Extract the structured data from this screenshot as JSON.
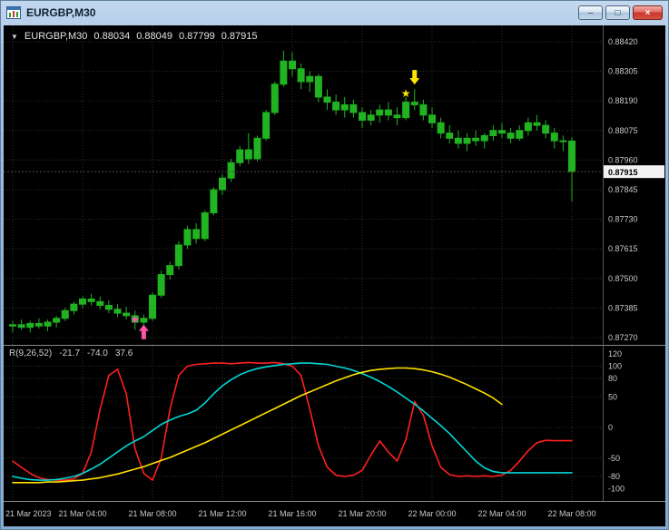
{
  "window": {
    "title": "EURGBP,M30",
    "controls": [
      {
        "name": "minimize",
        "glyph": "–"
      },
      {
        "name": "maximize",
        "glyph": "□"
      },
      {
        "name": "close",
        "glyph": "×"
      }
    ]
  },
  "colors": {
    "background": "#000000",
    "grid": "#2f2f2f",
    "candle": "#21b321",
    "axis_text": "#c9c9c9",
    "price_box_bg": "#f2f2f2",
    "price_box_text": "#000000",
    "separator": "#8a8a8a",
    "axis_separator": "#5a5a5a",
    "price_line": "#4a4a4a"
  },
  "chart_data": [
    {
      "type": "candlestick",
      "symbol": "EURGBP,M30",
      "collapse_marker": "▼",
      "ohlc_display": {
        "open": "0.88034",
        "high": "0.88049",
        "low": "0.87799",
        "close": "0.87915"
      },
      "x_tick_labels": [
        "21 Mar 2023",
        "21 Mar 04:00",
        "21 Mar 08:00",
        "21 Mar 12:00",
        "21 Mar 16:00",
        "21 Mar 20:00",
        "22 Mar 00:00",
        "22 Mar 04:00",
        "22 Mar 08:00"
      ],
      "ticks_per_label": 8,
      "y_axis_ticks": [
        "0.88420",
        "0.88305",
        "0.88190",
        "0.88075",
        "0.87960",
        "0.87845",
        "0.87730",
        "0.87615",
        "0.87500",
        "0.87385",
        "0.87270"
      ],
      "current_price": "0.87915",
      "candles": [
        [
          0.87315,
          0.87335,
          0.8729,
          0.8732
        ],
        [
          0.8732,
          0.8734,
          0.873,
          0.8731
        ],
        [
          0.8731,
          0.87335,
          0.8729,
          0.87325
        ],
        [
          0.87325,
          0.87345,
          0.87305,
          0.87315
        ],
        [
          0.87315,
          0.8734,
          0.87295,
          0.8733
        ],
        [
          0.8733,
          0.87355,
          0.8731,
          0.87345
        ],
        [
          0.87345,
          0.87385,
          0.87335,
          0.87375
        ],
        [
          0.87375,
          0.8741,
          0.8736,
          0.874
        ],
        [
          0.874,
          0.8743,
          0.87385,
          0.8742
        ],
        [
          0.8742,
          0.8744,
          0.87395,
          0.8741
        ],
        [
          0.8741,
          0.8743,
          0.8738,
          0.87395
        ],
        [
          0.87395,
          0.87415,
          0.87365,
          0.8738
        ],
        [
          0.8738,
          0.874,
          0.8735,
          0.87365
        ],
        [
          0.87365,
          0.8739,
          0.8734,
          0.87355
        ],
        [
          0.87355,
          0.87375,
          0.873,
          0.8733
        ],
        [
          0.8733,
          0.8736,
          0.87285,
          0.87345
        ],
        [
          0.87345,
          0.87445,
          0.87335,
          0.87435
        ],
        [
          0.87435,
          0.8753,
          0.87425,
          0.87515
        ],
        [
          0.87515,
          0.87565,
          0.87495,
          0.8755
        ],
        [
          0.8755,
          0.87645,
          0.87535,
          0.8763
        ],
        [
          0.8763,
          0.87705,
          0.87615,
          0.8769
        ],
        [
          0.8769,
          0.87715,
          0.87635,
          0.87655
        ],
        [
          0.87655,
          0.87765,
          0.87645,
          0.87755
        ],
        [
          0.87755,
          0.87855,
          0.87745,
          0.87845
        ],
        [
          0.87845,
          0.87905,
          0.87825,
          0.8789
        ],
        [
          0.8789,
          0.87965,
          0.87875,
          0.8795
        ],
        [
          0.8795,
          0.88015,
          0.87935,
          0.88
        ],
        [
          0.88,
          0.88065,
          0.87945,
          0.87965
        ],
        [
          0.87965,
          0.88055,
          0.87955,
          0.88045
        ],
        [
          0.88045,
          0.88155,
          0.88035,
          0.88145
        ],
        [
          0.88145,
          0.88265,
          0.88135,
          0.88255
        ],
        [
          0.88255,
          0.88385,
          0.88245,
          0.88345
        ],
        [
          0.88345,
          0.8838,
          0.88285,
          0.88315
        ],
        [
          0.88315,
          0.88335,
          0.88235,
          0.88265
        ],
        [
          0.88265,
          0.88305,
          0.88225,
          0.88285
        ],
        [
          0.88285,
          0.88295,
          0.88185,
          0.88205
        ],
        [
          0.88205,
          0.88235,
          0.88155,
          0.88185
        ],
        [
          0.88185,
          0.88215,
          0.88135,
          0.88155
        ],
        [
          0.88155,
          0.88205,
          0.88125,
          0.88175
        ],
        [
          0.88175,
          0.88195,
          0.88125,
          0.88145
        ],
        [
          0.88145,
          0.88165,
          0.88085,
          0.88115
        ],
        [
          0.88115,
          0.88155,
          0.88095,
          0.88135
        ],
        [
          0.88135,
          0.88175,
          0.88105,
          0.88155
        ],
        [
          0.88155,
          0.88185,
          0.88115,
          0.88135
        ],
        [
          0.88135,
          0.88165,
          0.88095,
          0.88125
        ],
        [
          0.88125,
          0.88205,
          0.88115,
          0.88185
        ],
        [
          0.88185,
          0.88235,
          0.88155,
          0.88175
        ],
        [
          0.88175,
          0.88195,
          0.88115,
          0.88135
        ],
        [
          0.88135,
          0.88165,
          0.88085,
          0.88105
        ],
        [
          0.88105,
          0.88125,
          0.88045,
          0.88065
        ],
        [
          0.88065,
          0.88095,
          0.88025,
          0.88045
        ],
        [
          0.88045,
          0.88075,
          0.88005,
          0.88025
        ],
        [
          0.88025,
          0.88065,
          0.87995,
          0.88045
        ],
        [
          0.88045,
          0.88075,
          0.88015,
          0.88035
        ],
        [
          0.88035,
          0.88065,
          0.88005,
          0.88055
        ],
        [
          0.88055,
          0.88095,
          0.88035,
          0.88075
        ],
        [
          0.88075,
          0.88105,
          0.88045,
          0.88065
        ],
        [
          0.88065,
          0.88085,
          0.88025,
          0.88045
        ],
        [
          0.88045,
          0.88095,
          0.88035,
          0.88075
        ],
        [
          0.88075,
          0.88125,
          0.88055,
          0.88105
        ],
        [
          0.88105,
          0.88135,
          0.88075,
          0.88095
        ],
        [
          0.88095,
          0.88115,
          0.88045,
          0.88065
        ],
        [
          0.88065,
          0.88085,
          0.88005,
          0.88035
        ],
        [
          0.88035,
          0.88055,
          0.87995,
          0.88034
        ],
        [
          0.88034,
          0.88049,
          0.87799,
          0.87915
        ]
      ],
      "markers": [
        {
          "shape": "star",
          "color": "#ff55aa",
          "candle": 14,
          "price": 0.8734
        },
        {
          "shape": "arrow-up",
          "color": "#ff55aa",
          "candle": 15,
          "price": 0.87292
        },
        {
          "shape": "star",
          "color": "#ffe400",
          "candle": 45,
          "price": 0.88219
        },
        {
          "shape": "arrow-down",
          "color": "#ffe400",
          "candle": 46,
          "price": 0.88282
        }
      ]
    },
    {
      "type": "line",
      "label": "R(9,26,52)",
      "current_values": [
        "-21.7",
        "-74.0",
        "37.6"
      ],
      "y_ticks": [
        "120",
        "100",
        "80",
        "50",
        "0",
        "-50",
        "-80",
        "-100"
      ],
      "y_range": [
        -120,
        131
      ],
      "series": [
        {
          "name": "r9",
          "color": "#ff2020",
          "values": [
            -55,
            -65,
            -75,
            -82,
            -85,
            -86,
            -86,
            -84,
            -75,
            -40,
            30,
            85,
            95,
            55,
            -35,
            -75,
            -86,
            -50,
            30,
            85,
            100,
            103,
            104,
            105,
            105,
            104,
            105,
            106,
            105,
            105,
            106,
            104,
            100,
            85,
            30,
            -30,
            -65,
            -78,
            -80,
            -78,
            -70,
            -45,
            -22,
            -40,
            -55,
            -20,
            42,
            20,
            -30,
            -65,
            -77,
            -80,
            -79,
            -80,
            -79,
            -80,
            -78,
            -70,
            -55,
            -38,
            -25,
            -21,
            -21.7,
            -21.7,
            -21.7
          ]
        },
        {
          "name": "r26",
          "color": "#00d8d8",
          "values": [
            -80,
            -83,
            -85,
            -86,
            -86,
            -85,
            -83,
            -80,
            -75,
            -68,
            -60,
            -50,
            -40,
            -30,
            -22,
            -15,
            -5,
            5,
            12,
            18,
            22,
            28,
            40,
            55,
            68,
            78,
            86,
            92,
            96,
            99,
            101,
            103,
            104,
            105,
            105,
            104,
            103,
            100,
            97,
            93,
            88,
            82,
            75,
            67,
            58,
            48,
            38,
            27,
            15,
            3,
            -10,
            -25,
            -40,
            -55,
            -66,
            -72,
            -74,
            -74,
            -74,
            -74,
            -74,
            -74,
            -74,
            -74,
            -74
          ]
        },
        {
          "name": "r52",
          "color": "#ffe100",
          "values": [
            -90,
            -90,
            -90,
            -90,
            -89,
            -89,
            -88,
            -87,
            -86,
            -84,
            -82,
            -79,
            -76,
            -72,
            -68,
            -64,
            -59,
            -54,
            -49,
            -43,
            -37,
            -31,
            -25,
            -18,
            -11,
            -4,
            3,
            10,
            17,
            24,
            31,
            38,
            45,
            52,
            58,
            64,
            70,
            76,
            81,
            86,
            90,
            93,
            95,
            96,
            97,
            97,
            96,
            94,
            91,
            87,
            82,
            76,
            70,
            63,
            56,
            48,
            37.6,
            null,
            null,
            null,
            null,
            null,
            null,
            null,
            null
          ]
        }
      ]
    }
  ]
}
